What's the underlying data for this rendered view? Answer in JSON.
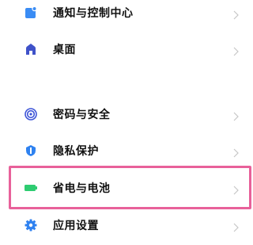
{
  "settings": {
    "items": [
      {
        "label": "通知与控制中心",
        "icon": "notification-icon"
      },
      {
        "label": "桌面",
        "icon": "home-icon"
      },
      {
        "label": "密码与安全",
        "icon": "fingerprint-icon"
      },
      {
        "label": "隐私保护",
        "icon": "privacy-icon"
      },
      {
        "label": "省电与电池",
        "icon": "battery-icon"
      },
      {
        "label": "应用设置",
        "icon": "gear-icon"
      }
    ]
  },
  "colors": {
    "notification": "#3a8cf4",
    "home": "#3f52c9",
    "fingerprint": "#3e55d8",
    "privacy": "#2f82f0",
    "battery": "#2ecc71",
    "gear": "#2f82f0",
    "highlight": "#e8619a",
    "chevron": "#c6c6c6"
  }
}
